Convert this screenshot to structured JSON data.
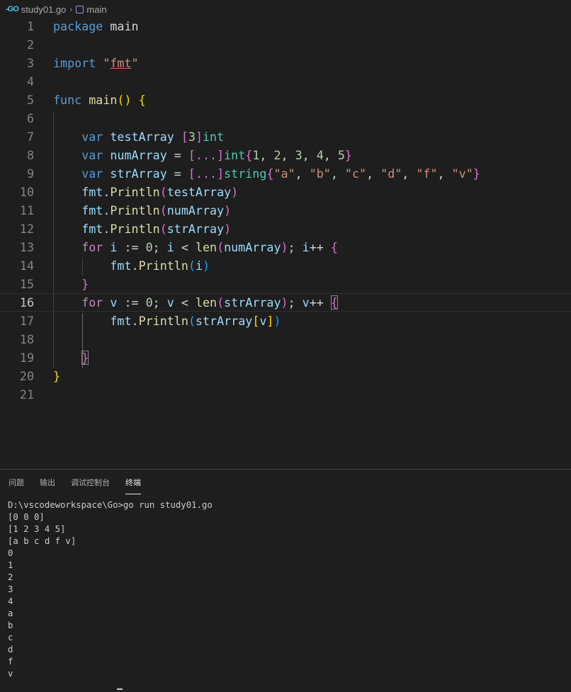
{
  "breadcrumb": {
    "file": "study01.go",
    "symbol": "main"
  },
  "editor": {
    "line_numbers": [
      "1",
      "2",
      "3",
      "4",
      "5",
      "6",
      "7",
      "8",
      "9",
      "10",
      "11",
      "12",
      "13",
      "14",
      "15",
      "16",
      "17",
      "18",
      "19",
      "20",
      "21"
    ],
    "active_line": 16,
    "lines": [
      [
        [
          "kw",
          "package"
        ],
        [
          "plain",
          " main"
        ]
      ],
      [],
      [
        [
          "kw",
          "import"
        ],
        [
          "plain",
          " "
        ],
        [
          "str",
          "\""
        ],
        [
          "str u",
          "fmt"
        ],
        [
          "str",
          "\""
        ]
      ],
      [],
      [
        [
          "kw",
          "func"
        ],
        [
          "plain",
          " "
        ],
        [
          "fn",
          "main"
        ],
        [
          "br1",
          "()"
        ],
        [
          "plain",
          " "
        ],
        [
          "br1",
          "{"
        ]
      ],
      [],
      [
        [
          "plain",
          "    "
        ],
        [
          "kw",
          "var"
        ],
        [
          "plain",
          " "
        ],
        [
          "var",
          "testArray"
        ],
        [
          "plain",
          " "
        ],
        [
          "br2",
          "["
        ],
        [
          "num",
          "3"
        ],
        [
          "br2",
          "]"
        ],
        [
          "typ",
          "int"
        ]
      ],
      [
        [
          "plain",
          "    "
        ],
        [
          "kw",
          "var"
        ],
        [
          "plain",
          " "
        ],
        [
          "var",
          "numArray"
        ],
        [
          "plain",
          " = "
        ],
        [
          "br2",
          "[...]"
        ],
        [
          "typ",
          "int"
        ],
        [
          "br2",
          "{"
        ],
        [
          "num",
          "1"
        ],
        [
          "plain",
          ", "
        ],
        [
          "num",
          "2"
        ],
        [
          "plain",
          ", "
        ],
        [
          "num",
          "3"
        ],
        [
          "plain",
          ", "
        ],
        [
          "num",
          "4"
        ],
        [
          "plain",
          ", "
        ],
        [
          "num",
          "5"
        ],
        [
          "br2",
          "}"
        ]
      ],
      [
        [
          "plain",
          "    "
        ],
        [
          "kw",
          "var"
        ],
        [
          "plain",
          " "
        ],
        [
          "var",
          "strArray"
        ],
        [
          "plain",
          " = "
        ],
        [
          "br2",
          "[...]"
        ],
        [
          "typ",
          "string"
        ],
        [
          "br2",
          "{"
        ],
        [
          "str",
          "\"a\""
        ],
        [
          "plain",
          ", "
        ],
        [
          "str",
          "\"b\""
        ],
        [
          "plain",
          ", "
        ],
        [
          "str",
          "\"c\""
        ],
        [
          "plain",
          ", "
        ],
        [
          "str",
          "\"d\""
        ],
        [
          "plain",
          ", "
        ],
        [
          "str",
          "\"f\""
        ],
        [
          "plain",
          ", "
        ],
        [
          "str",
          "\"v\""
        ],
        [
          "br2",
          "}"
        ]
      ],
      [
        [
          "plain",
          "    "
        ],
        [
          "var",
          "fmt"
        ],
        [
          "plain",
          "."
        ],
        [
          "fn",
          "Println"
        ],
        [
          "br2",
          "("
        ],
        [
          "var",
          "testArray"
        ],
        [
          "br2",
          ")"
        ]
      ],
      [
        [
          "plain",
          "    "
        ],
        [
          "var",
          "fmt"
        ],
        [
          "plain",
          "."
        ],
        [
          "fn",
          "Println"
        ],
        [
          "br2",
          "("
        ],
        [
          "var",
          "numArray"
        ],
        [
          "br2",
          ")"
        ]
      ],
      [
        [
          "plain",
          "    "
        ],
        [
          "var",
          "fmt"
        ],
        [
          "plain",
          "."
        ],
        [
          "fn",
          "Println"
        ],
        [
          "br2",
          "("
        ],
        [
          "var",
          "strArray"
        ],
        [
          "br2",
          ")"
        ]
      ],
      [
        [
          "plain",
          "    "
        ],
        [
          "ctl",
          "for"
        ],
        [
          "plain",
          " "
        ],
        [
          "var",
          "i"
        ],
        [
          "plain",
          " := "
        ],
        [
          "num",
          "0"
        ],
        [
          "plain",
          "; "
        ],
        [
          "var",
          "i"
        ],
        [
          "plain",
          " < "
        ],
        [
          "fn",
          "len"
        ],
        [
          "br2",
          "("
        ],
        [
          "var",
          "numArray"
        ],
        [
          "br2",
          ")"
        ],
        [
          "plain",
          "; "
        ],
        [
          "var",
          "i"
        ],
        [
          "plain",
          "++ "
        ],
        [
          "br2",
          "{"
        ]
      ],
      [
        [
          "plain",
          "        "
        ],
        [
          "var",
          "fmt"
        ],
        [
          "plain",
          "."
        ],
        [
          "fn",
          "Println"
        ],
        [
          "br3",
          "("
        ],
        [
          "var",
          "i"
        ],
        [
          "br3",
          ")"
        ]
      ],
      [
        [
          "plain",
          "    "
        ],
        [
          "br2",
          "}"
        ]
      ],
      [
        [
          "plain",
          "    "
        ],
        [
          "ctl",
          "for"
        ],
        [
          "plain",
          " "
        ],
        [
          "var",
          "v"
        ],
        [
          "plain",
          " := "
        ],
        [
          "num",
          "0"
        ],
        [
          "plain",
          "; "
        ],
        [
          "var",
          "v"
        ],
        [
          "plain",
          " < "
        ],
        [
          "fn",
          "len"
        ],
        [
          "br2",
          "("
        ],
        [
          "var",
          "strArray"
        ],
        [
          "br2",
          ")"
        ],
        [
          "plain",
          "; "
        ],
        [
          "var",
          "v"
        ],
        [
          "plain",
          "++ "
        ],
        [
          "br2 hl",
          "{"
        ]
      ],
      [
        [
          "plain",
          "        "
        ],
        [
          "var",
          "fmt"
        ],
        [
          "plain",
          "."
        ],
        [
          "fn",
          "Println"
        ],
        [
          "br3",
          "("
        ],
        [
          "var",
          "strArray"
        ],
        [
          "br1",
          "["
        ],
        [
          "var",
          "v"
        ],
        [
          "br1",
          "]"
        ],
        [
          "br3",
          ")"
        ]
      ],
      [],
      [
        [
          "plain",
          "    "
        ],
        [
          "br2 hl",
          "}"
        ]
      ],
      [
        [
          "br1",
          "}"
        ]
      ],
      []
    ]
  },
  "panel": {
    "tabs": [
      "问题",
      "输出",
      "调试控制台",
      "终端"
    ],
    "active_tab": 3,
    "terminal_lines": [
      "D:\\vscodeworkspace\\Go>go run study01.go",
      "[0 0 0]",
      "[1 2 3 4 5]",
      "[a b c d f v]",
      "0",
      "1",
      "2",
      "3",
      "4",
      "a",
      "b",
      "c",
      "d",
      "f",
      "v"
    ]
  },
  "colors": {
    "background": "#1e1e1e",
    "keyword": "#569cd6",
    "control": "#c586c0",
    "function": "#dcdcaa",
    "string": "#ce9178",
    "number": "#b5cea8",
    "type": "#4ec9b0",
    "variable": "#9cdcfe"
  }
}
